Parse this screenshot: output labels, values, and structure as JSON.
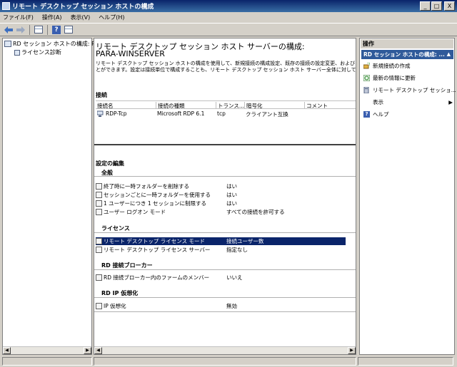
{
  "window": {
    "title": "リモート デスクトップ セッション ホストの構成",
    "buttons": {
      "minimize": "_",
      "maximize": "□",
      "close": "X"
    }
  },
  "menu": [
    "ファイル(F)",
    "操作(A)",
    "表示(V)",
    "ヘルプ(H)"
  ],
  "tree": {
    "items": [
      {
        "label": "RD セッション ホストの構成: PAF"
      },
      {
        "label": "ライセンス診断"
      }
    ]
  },
  "main": {
    "title": "リモート デスクトップ セッション ホスト サーバーの構成:",
    "server": "PARA-WINSERVER",
    "description_line1": "リモート デスクトップ セッション ホストの構成を使用して、新規接続の構成設定、既存の接続の設定変更、および",
    "description_line2": "とができます。設定は接続単位で構成することも、リモート デスクトップ セッション ホスト サーバー全体に対して構成",
    "connections_heading": "接続",
    "columns": [
      "接続名",
      "接続の種類",
      "トランス...",
      "暗号化",
      "コメント"
    ],
    "connections": [
      {
        "name": "RDP-Tcp",
        "type": "Microsoft RDP 6.1",
        "transport": "tcp",
        "encryption": "クライアント互換",
        "comment": ""
      }
    ],
    "edit_heading": "設定の編集",
    "groups": {
      "general": {
        "title": "全般",
        "rows": [
          {
            "label": "終了時に一時フォルダーを削除する",
            "value": "はい"
          },
          {
            "label": "セッションごとに一時フォルダーを使用する",
            "value": "はい"
          },
          {
            "label": "1 ユーザーにつき 1 セッションに制限する",
            "value": "はい"
          },
          {
            "label": "ユーザー ログオン モード",
            "value": "すべての接続を許可する"
          }
        ]
      },
      "license": {
        "title": "ライセンス",
        "rows": [
          {
            "label": "リモート デスクトップ ライセンス モード",
            "value": "接続ユーザー数"
          },
          {
            "label": "リモート デスクトップ ライセンス サーバー",
            "value": "指定なし"
          }
        ]
      },
      "broker": {
        "title": "RD 接続ブローカー",
        "rows": [
          {
            "label": "RD 接続ブローカー内のファームのメンバー",
            "value": "いいえ"
          }
        ]
      },
      "ipv": {
        "title": "RD IP 仮想化",
        "rows": [
          {
            "label": "IP 仮想化",
            "value": "無効"
          }
        ]
      }
    }
  },
  "actions": {
    "title": "操作",
    "section": "RD セッション ホストの構成: ...",
    "items": [
      {
        "label": "新規接続の作成"
      },
      {
        "label": "最新の情報に更新"
      },
      {
        "label": "リモート デスクトップ セッショ..."
      },
      {
        "label": "表示"
      },
      {
        "label": "ヘルプ"
      }
    ]
  },
  "colors": {
    "selection": "#0a246a",
    "actionbar": "#2f5a9a",
    "titlebar": "#0a246a"
  }
}
